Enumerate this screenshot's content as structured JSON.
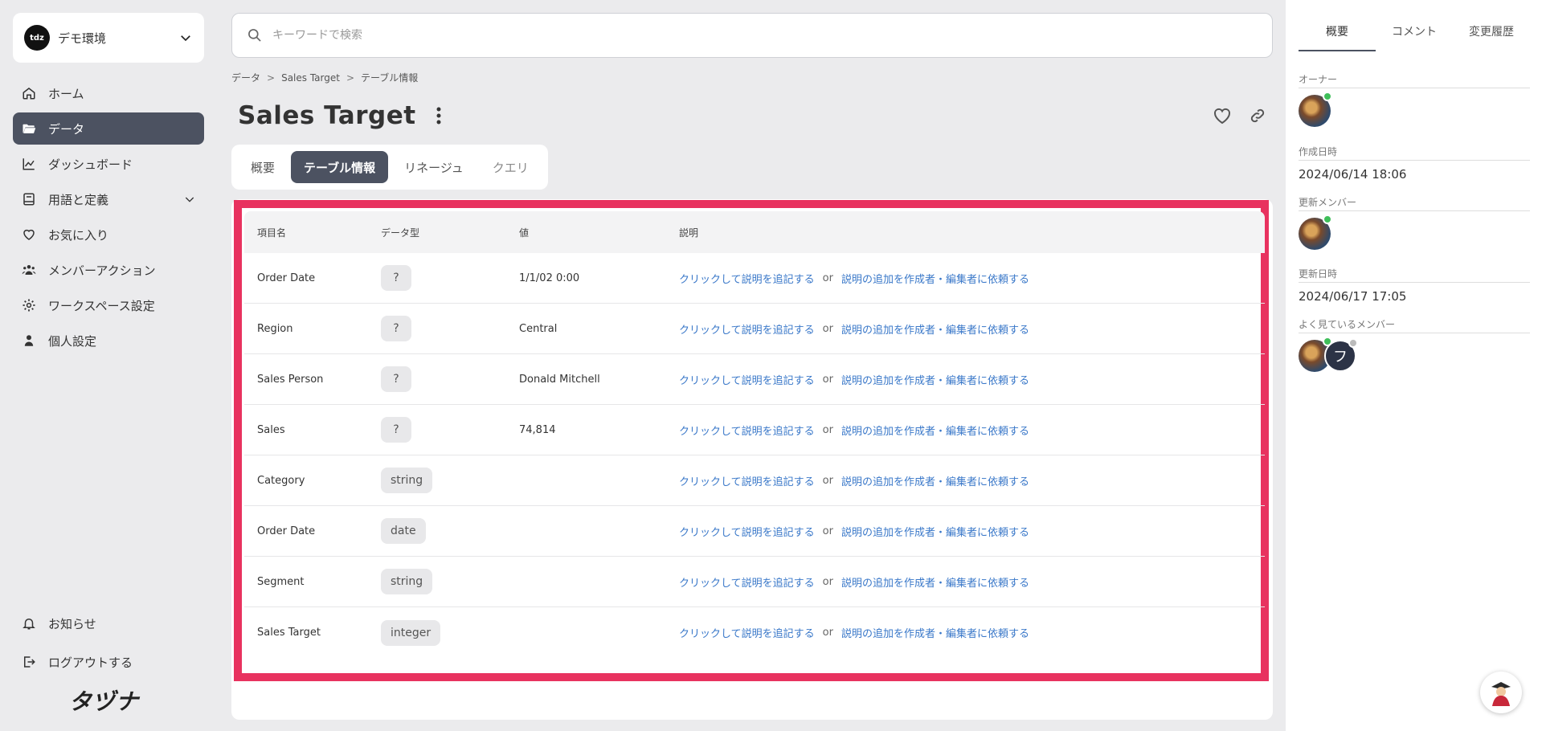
{
  "workspace": {
    "logo_text": "tdz",
    "name": "デモ環境"
  },
  "nav": {
    "items": [
      {
        "label": "ホーム",
        "icon": "home-icon"
      },
      {
        "label": "データ",
        "icon": "folder-icon",
        "active": true
      },
      {
        "label": "ダッシュボード",
        "icon": "chart-icon"
      },
      {
        "label": "用語と定義",
        "icon": "book-icon"
      },
      {
        "label": "お気に入り",
        "icon": "heart-icon"
      },
      {
        "label": "メンバーアクション",
        "icon": "users-icon"
      },
      {
        "label": "ワークスペース設定",
        "icon": "gear-icon"
      },
      {
        "label": "個人設定",
        "icon": "person-icon"
      }
    ],
    "bottom": [
      {
        "label": "お知らせ",
        "icon": "bell-icon"
      },
      {
        "label": "ログアウトする",
        "icon": "logout-icon"
      }
    ],
    "brand": "タヅナ"
  },
  "search": {
    "placeholder": "キーワードで検索"
  },
  "breadcrumb": [
    "データ",
    "Sales Target",
    "テーブル情報"
  ],
  "page": {
    "title": "Sales Target"
  },
  "tabs": [
    {
      "label": "概要"
    },
    {
      "label": "テーブル情報",
      "active": true
    },
    {
      "label": "リネージュ"
    },
    {
      "label": "クエリ"
    }
  ],
  "table": {
    "headers": [
      "項目名",
      "データ型",
      "値",
      "説明"
    ],
    "link_add": "クリックして説明を追記する",
    "or": "or",
    "link_request": "説明の追加を作成者・編集者に依頼する",
    "rows": [
      {
        "name": "Order Date",
        "type": "?",
        "value": "1/1/02 0:00"
      },
      {
        "name": "Region",
        "type": "?",
        "value": "Central"
      },
      {
        "name": "Sales Person",
        "type": "?",
        "value": "Donald Mitchell"
      },
      {
        "name": "Sales",
        "type": "?",
        "value": "74,814"
      },
      {
        "name": "Category",
        "type": "string",
        "value": ""
      },
      {
        "name": "Order Date",
        "type": "date",
        "value": ""
      },
      {
        "name": "Segment",
        "type": "string",
        "value": ""
      },
      {
        "name": "Sales Target",
        "type": "integer",
        "value": ""
      }
    ]
  },
  "right": {
    "tabs": [
      "概要",
      "コメント",
      "変更履歴"
    ],
    "owner_label": "オーナー",
    "created_label": "作成日時",
    "created_value": "2024/06/14 18:06",
    "updated_member_label": "更新メンバー",
    "updated_label": "更新日時",
    "updated_value": "2024/06/17 17:05",
    "viewers_label": "よく見ているメンバー",
    "viewer_initial": "フ"
  },
  "colors": {
    "accent": "#4c5261",
    "highlight": "#e8325f",
    "link": "#3a78c9",
    "online": "#3fbf5a"
  }
}
